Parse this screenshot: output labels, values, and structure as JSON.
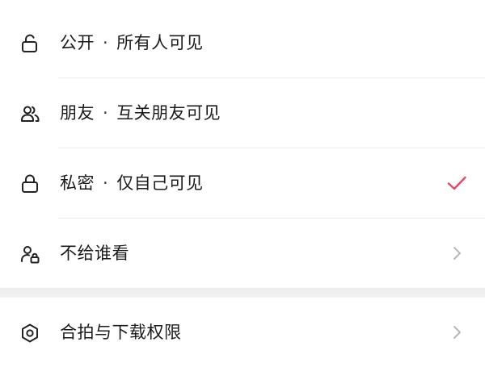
{
  "visibility_options": [
    {
      "label": "公开",
      "desc": "所有人可见",
      "icon": "unlock-icon"
    },
    {
      "label": "朋友",
      "desc": "互关朋友可见",
      "icon": "friends-icon"
    },
    {
      "label": "私密",
      "desc": "仅自己可见",
      "icon": "lock-icon",
      "selected": true
    }
  ],
  "separator": "·",
  "hide_from": {
    "label": "不给谁看",
    "icon": "user-lock-icon"
  },
  "permissions": {
    "label": "合拍与下载权限",
    "icon": "hexagon-settings-icon"
  },
  "colors": {
    "accent": "#e8456b",
    "chevron": "#b8b8b8",
    "icon": "#222222"
  }
}
